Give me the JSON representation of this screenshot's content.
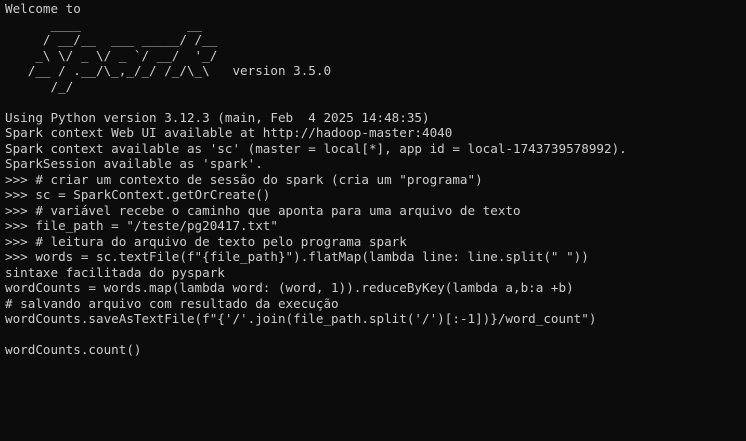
{
  "terminal": {
    "lines": [
      "Welcome to",
      "      ____              __",
      "     / __/__  ___ _____/ /__",
      "    _\\ \\/ _ \\/ _ `/ __/  '_/",
      "   /__ / .__/\\_,_/_/ /_/\\_\\   version 3.5.0",
      "      /_/",
      "",
      "Using Python version 3.12.3 (main, Feb  4 2025 14:48:35)",
      "Spark context Web UI available at http://hadoop-master:4040",
      "Spark context available as 'sc' (master = local[*], app id = local-1743739578992).",
      "SparkSession available as 'spark'.",
      ">>> # criar um contexto de sessão do spark (cria um \"programa\")",
      ">>> sc = SparkContext.getOrCreate()",
      ">>> # variável recebe o caminho que aponta para uma arquivo de texto",
      ">>> file_path = \"/teste/pg20417.txt\"",
      ">>> # leitura do arquivo de texto pelo programa spark",
      ">>> words = sc.textFile(f\"{file_path}\").flatMap(lambda line: line.split(\" \"))",
      "sintaxe facilitada do pyspark",
      "wordCounts = words.map(lambda word: (word, 1)).reduceByKey(lambda a,b:a +b)",
      "# salvando arquivo com resultado da execução",
      "wordCounts.saveAsTextFile(f\"{'/'.join(file_path.split('/')[:-1])}/word_count\")",
      "",
      "wordCounts.count()"
    ]
  }
}
